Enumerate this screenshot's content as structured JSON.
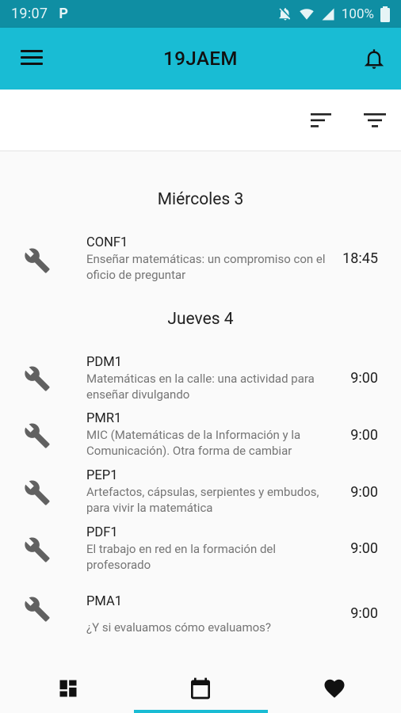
{
  "status_bar": {
    "time": "19:07",
    "app_indicator": "P",
    "battery": "100%",
    "icons": [
      "mute-icon",
      "wifi-icon",
      "signal-icon",
      "battery-icon"
    ]
  },
  "app_bar": {
    "title": "19JAEM",
    "icons": [
      "menu-icon",
      "bell-icon"
    ]
  },
  "toolbar": {
    "icons": [
      "sort-icon",
      "filter-icon"
    ]
  },
  "schedule": [
    {
      "day": "Miércoles 3",
      "events": [
        {
          "code": "CONF1",
          "description": "Enseñar matemáticas: un compromiso con el oficio de preguntar",
          "time": "18:45",
          "icon": "wrench-icon"
        }
      ]
    },
    {
      "day": "Jueves 4",
      "events": [
        {
          "code": "PDM1",
          "description": "Matemáticas en la calle: una actividad para enseñar divulgando",
          "time": "9:00",
          "icon": "wrench-icon"
        },
        {
          "code": "PMR1",
          "description": "MIC (Matemáticas de la Información y la Comunicación). Otra forma de cambiar",
          "time": "9:00",
          "icon": "wrench-icon"
        },
        {
          "code": "PEP1",
          "description": "Artefactos, cápsulas, serpientes y embudos, para vivir la matemática",
          "time": "9:00",
          "icon": "wrench-icon"
        },
        {
          "code": "PDF1",
          "description": "El trabajo en red en la formación del profesorado",
          "time": "9:00",
          "icon": "wrench-icon"
        },
        {
          "code": "PMA1",
          "description": "¿Y si evaluamos cómo evaluamos?",
          "time": "9:00",
          "icon": "wrench-icon"
        }
      ]
    }
  ],
  "bottom_nav": {
    "items": [
      {
        "icon": "dashboard-icon",
        "selected": false
      },
      {
        "icon": "calendar-icon",
        "selected": true
      },
      {
        "icon": "heart-icon",
        "selected": false
      }
    ],
    "accent_color": "#19bcd4"
  },
  "colors": {
    "status_bar": "#0f8ea3",
    "app_bar": "#19bcd4",
    "background": "#fafafa"
  }
}
